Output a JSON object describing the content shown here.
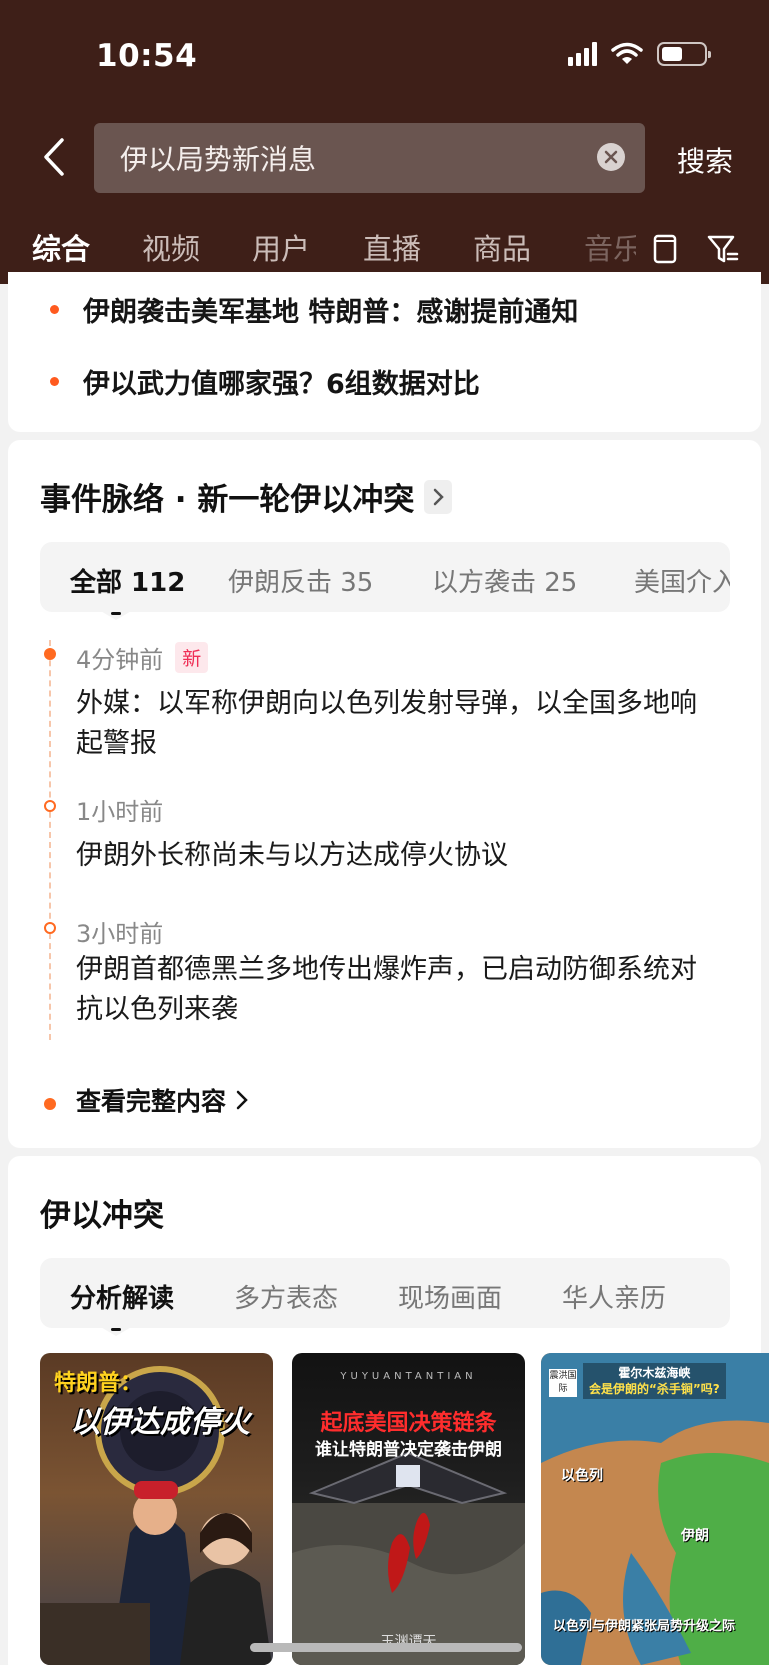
{
  "status": {
    "time": "10:54"
  },
  "search": {
    "query": "伊以局势新消息",
    "submit_label": "搜索"
  },
  "tabs": [
    "综合",
    "视频",
    "用户",
    "直播",
    "商品",
    "音乐"
  ],
  "headlines": [
    "伊朗袭击美军基地 特朗普：感谢提前通知",
    "伊以武力值哪家强？6组数据对比"
  ],
  "timeline": {
    "title": "事件脉络 · 新一轮伊以冲突",
    "filters": [
      "全部 112",
      "伊朗反击 35",
      "以方袭击 25",
      "美国介入"
    ],
    "new_badge": "新",
    "items": [
      {
        "time": "4分钟前",
        "text": "外媒：以军称伊朗向以色列发射导弹，以全国多地响起警报"
      },
      {
        "time": "1小时前",
        "text": "伊朗外长称尚未与以方达成停火协议"
      },
      {
        "time": "3小时前",
        "text": "伊朗首都德黑兰多地传出爆炸声，已启动防御系统对抗以色列来袭"
      }
    ],
    "see_all": "查看完整内容"
  },
  "topic": {
    "title": "伊以冲突",
    "tabs": [
      "分析解读",
      "多方表态",
      "现场画面",
      "华人亲历"
    ],
    "videos": [
      {
        "caption_line1": "特朗普：",
        "caption_line2": "以伊达成停火"
      },
      {
        "brand": "YUYUANTANTIAN",
        "caption_line1": "起底美国决策链条",
        "caption_line2": "谁让特朗普决定袭击伊朗",
        "watermark": "玉渊谭天"
      },
      {
        "badge": "霍尔木兹海峡",
        "badge_line2": "会是伊朗的“杀手锏”吗?",
        "source": "震洪国际",
        "label_israel": "以色列",
        "label_iran": "伊朗",
        "bottom_text": "以色列与伊朗紧张局势升级之际"
      }
    ]
  },
  "colors": {
    "header_bg": "#3e1f18",
    "accent": "#ff6a21",
    "badge_red": "#ef2e55"
  }
}
